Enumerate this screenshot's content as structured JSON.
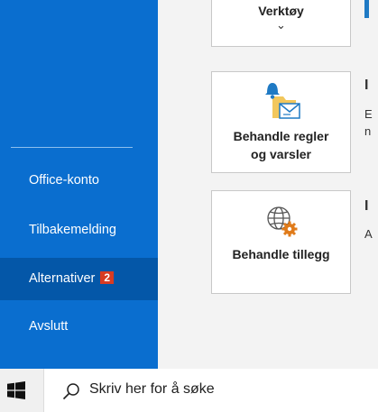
{
  "sidebar": {
    "items": [
      {
        "label": "Office-konto"
      },
      {
        "label": "Tilbakemelding"
      },
      {
        "label": "Alternativer",
        "badge": "2"
      },
      {
        "label": "Avslutt"
      }
    ]
  },
  "cards": {
    "tools": {
      "label": "Verktøy",
      "chevron": "⌄"
    },
    "rules": {
      "line1": "Behandle regler",
      "line2": "og varsler",
      "icon": "rules-alerts-icon"
    },
    "addins": {
      "label": "Behandle tillegg",
      "icon": "globe-gear-icon"
    }
  },
  "right_clipped": {
    "rules_heading": "I",
    "rules_desc": [
      "E",
      "n"
    ],
    "addins_heading": "I",
    "addins_desc": "A"
  },
  "taskbar": {
    "start_icon": "windows-logo-icon",
    "search_icon": "search-icon",
    "search_placeholder": "Skriv her for å søke"
  },
  "colors": {
    "sidebar": "#0a6ecf",
    "sidebar_active": "#0457a8",
    "badge": "#d83b22",
    "accent": "#1f7ac4",
    "gear": "#e07b1a"
  }
}
